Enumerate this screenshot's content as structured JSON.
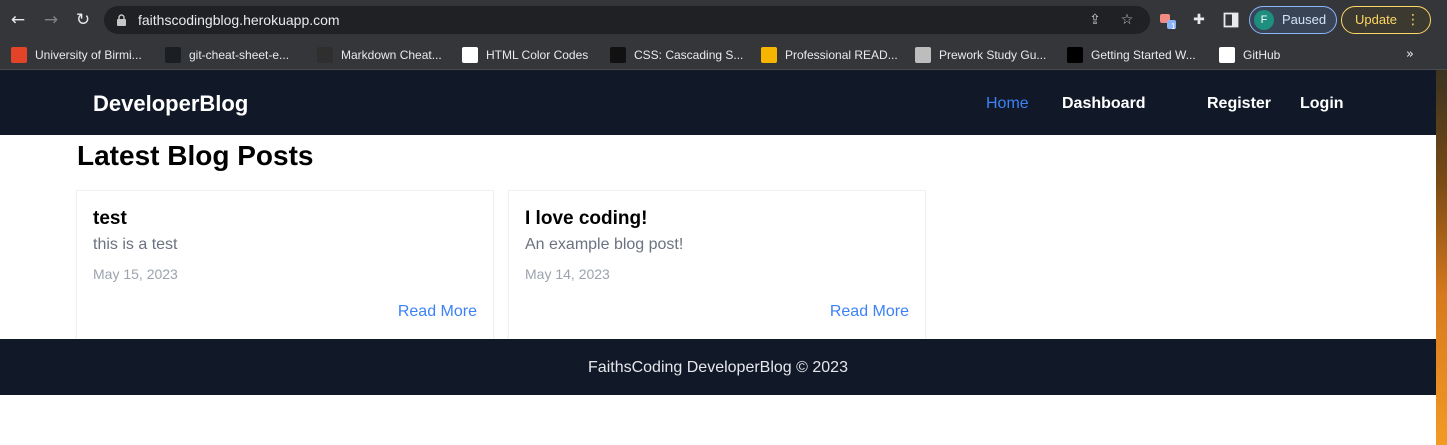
{
  "browser": {
    "url": "faithscodingblog.herokuapp.com",
    "profile": {
      "initial": "F",
      "status": "Paused"
    },
    "update_label": "Update",
    "extension_badge": "1",
    "bookmarks": [
      {
        "label": "University of Birmi...",
        "icon": "gitlab-icon",
        "color": "#e24329"
      },
      {
        "label": "git-cheat-sheet-e...",
        "icon": "github-icon",
        "color": "#1b1f23"
      },
      {
        "label": "Markdown Cheat...",
        "icon": "page-icon",
        "color": "#2f2f2f"
      },
      {
        "label": "HTML Color Codes",
        "icon": "html-color-codes-icon",
        "color": "#ffffff"
      },
      {
        "label": "CSS: Cascading S...",
        "icon": "mdn-icon",
        "color": "#111111"
      },
      {
        "label": "Professional READ...",
        "icon": "readme-icon",
        "color": "#f7b500"
      },
      {
        "label": "Prework Study Gu...",
        "icon": "globe-icon",
        "color": "#bdbdbd"
      },
      {
        "label": "Getting Started W...",
        "icon": "medium-icon",
        "color": "#000000"
      },
      {
        "label": "GitHub",
        "icon": "github-icon",
        "color": "#ffffff"
      }
    ]
  },
  "site": {
    "brand": "DeveloperBlog",
    "nav": [
      {
        "label": "Home",
        "active": true
      },
      {
        "label": "Dashboard",
        "active": false
      },
      {
        "label": "Register",
        "active": false
      },
      {
        "label": "Login",
        "active": false
      }
    ],
    "heading": "Latest Blog Posts",
    "posts": [
      {
        "title": "test",
        "description": "this is a test",
        "date": "May 15, 2023",
        "link": "Read More"
      },
      {
        "title": "I love coding!",
        "description": "An example blog post!",
        "date": "May 14, 2023",
        "link": "Read More"
      }
    ],
    "footer": "FaithsCoding DeveloperBlog © 2023"
  },
  "colors": {
    "header_bg": "#111827",
    "accent": "#3b82f6",
    "muted_text": "#6b7280"
  }
}
